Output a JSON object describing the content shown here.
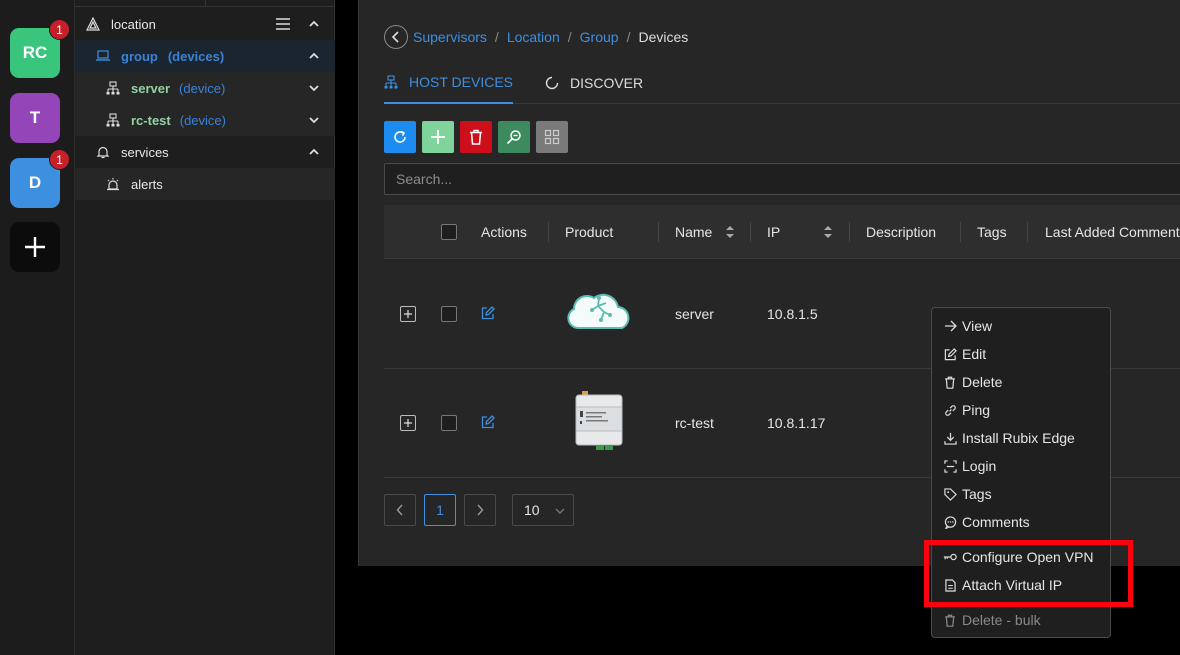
{
  "rail": {
    "apps": [
      {
        "label": "RC",
        "color": "#3ac57d",
        "badge": "1"
      },
      {
        "label": "T",
        "color": "#9445b8",
        "badge": ""
      },
      {
        "label": "D",
        "color": "#3d8fe0",
        "badge": "1"
      }
    ]
  },
  "tree": {
    "location": "location",
    "group": {
      "name": "group",
      "suffix": "(devices)"
    },
    "devices": [
      {
        "name": "server",
        "suffix": "(device)"
      },
      {
        "name": "rc-test",
        "suffix": "(device)"
      }
    ],
    "services": "services",
    "alerts": "alerts"
  },
  "breadcrumb": {
    "items": [
      "Supervisors",
      "Location",
      "Group"
    ],
    "current": "Devices"
  },
  "tabs": [
    {
      "label": "HOST DEVICES",
      "active": true
    },
    {
      "label": "DISCOVER",
      "active": false
    }
  ],
  "toolbar": {
    "colors": {
      "refresh": "#1d8cf0",
      "add": "#7fd39b",
      "delete": "#cc0f1a",
      "scan": "#3d8a5f",
      "grid": "#7a7a7a"
    }
  },
  "search": {
    "placeholder": "Search..."
  },
  "table": {
    "headers": [
      "Actions",
      "Product",
      "Name",
      "IP",
      "Description",
      "Tags",
      "Last Added Comment"
    ],
    "rows": [
      {
        "name": "server",
        "ip": "10.8.1.5",
        "product": "cloud-device-image"
      },
      {
        "name": "rc-test",
        "ip": "10.8.1.17",
        "product": "din-rail-controller-image"
      }
    ]
  },
  "pagination": {
    "current": "1",
    "page_size": "10"
  },
  "context_menu": {
    "items": [
      {
        "label": "View",
        "icon": "arrow-right-icon"
      },
      {
        "label": "Edit",
        "icon": "edit-icon"
      },
      {
        "label": "Delete",
        "icon": "trash-icon"
      },
      {
        "label": "Ping",
        "icon": "link-icon"
      },
      {
        "label": "Install Rubix Edge",
        "icon": "download-icon"
      },
      {
        "label": "Login",
        "icon": "login-icon"
      },
      {
        "label": "Tags",
        "icon": "tag-icon"
      },
      {
        "label": "Comments",
        "icon": "comments-icon"
      },
      {
        "label": "Configure Open VPN",
        "icon": "key-icon"
      },
      {
        "label": "Attach Virtual IP",
        "icon": "file-icon"
      },
      {
        "label": "Delete - bulk",
        "icon": "trash-icon",
        "disabled": true
      }
    ]
  }
}
